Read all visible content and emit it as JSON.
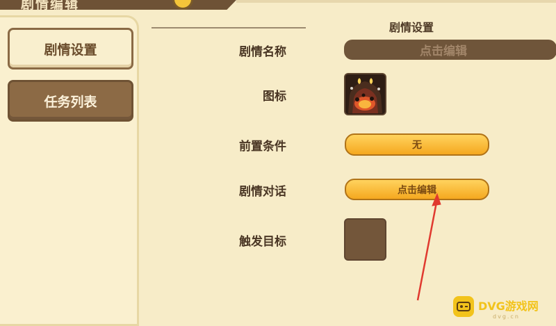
{
  "header": {
    "title": "剧情编辑"
  },
  "sidebar": {
    "items": [
      {
        "label": "剧情设置",
        "active": true
      },
      {
        "label": "任务列表",
        "active": false
      }
    ]
  },
  "main": {
    "section_title": "剧情设置",
    "rows": {
      "name": {
        "label": "剧情名称",
        "value": "点击编辑"
      },
      "icon": {
        "label": "图标",
        "icon_name": "dungeon-lava-icon"
      },
      "precondition": {
        "label": "前置条件",
        "value": "无"
      },
      "dialogue": {
        "label": "剧情对话",
        "value": "点击编辑"
      },
      "trigger": {
        "label": "触发目标",
        "icon_name": "empty-slot"
      }
    }
  },
  "watermark": {
    "brand": "DVG游戏网",
    "url": "dvg.cn"
  },
  "colors": {
    "background": "#f7ecc8",
    "accent_orange": "#f5a81f",
    "dark_brown": "#6f553a",
    "arrow_red": "#e0392f"
  }
}
